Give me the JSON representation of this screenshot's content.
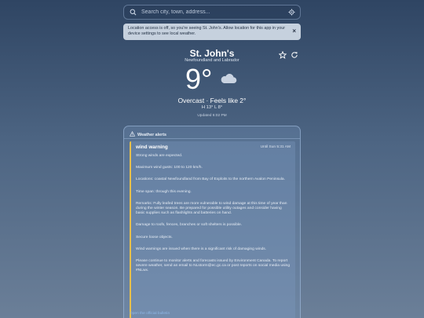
{
  "search": {
    "placeholder": "Search city, town, address..."
  },
  "notice": {
    "text": "Location access is off, so you're seeing St. John's. Allow location for this app in your device settings to see local weather.",
    "close": "×"
  },
  "location": {
    "city": "St. John's",
    "region": "Newfoundland and Labrador"
  },
  "current": {
    "temp": "9°",
    "condition": "Overcast · Feels like 2°",
    "hilo": "H 13° L 8°",
    "updated": "Updated 6:02 PM"
  },
  "alerts": {
    "header": "Weather alerts",
    "card": {
      "title": "wind warning",
      "until": "Until Sun 5:31 AM",
      "paragraphs": [
        "Strong winds are expected.",
        "Maximum wind gusts: 100 to 120 km/h.",
        "Locations: coastal Newfoundland from Bay of Exploits to the northern Avalon Peninsula.",
        "Time span: through this evening.",
        "Remarks: Fully leafed trees are more vulnerable to wind damage at this time of year than during the winter season. Be prepared for possible utility outages and consider having basic supplies such as flashlights and batteries on hand.",
        "Damage to roofs, fences, branches or soft shelters is possible.",
        "Secure loose objects.",
        "Wind warnings are issued when there is a significant risk of damaging winds.",
        "Please continue to monitor alerts and forecasts issued by Environment Canada. To report severe weather, send an email to NLstorm@ec.gc.ca or post reports on social media using #NLwx."
      ]
    },
    "link": "Open the official bulletin"
  },
  "colors": {
    "accent": "#e8c04a",
    "link": "#8fb7e6"
  },
  "icons": [
    "search-icon",
    "locate-icon",
    "close-icon",
    "star-icon",
    "refresh-icon",
    "cloud-icon",
    "warning-icon"
  ]
}
